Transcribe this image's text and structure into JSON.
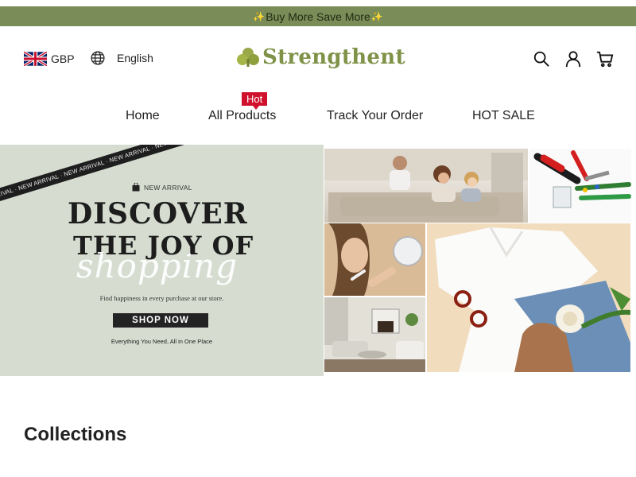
{
  "announcement": {
    "text": "Buy More Save More",
    "spark": "✨"
  },
  "header": {
    "currency": "GBP",
    "language": "English",
    "brand": "Strengthent",
    "colors": {
      "brand": "#7f9248",
      "announcement_bg": "#7a8c57",
      "hot_badge": "#d0112b"
    }
  },
  "nav": {
    "items": [
      {
        "label": "Home"
      },
      {
        "label": "All Products",
        "badge": "Hot"
      },
      {
        "label": "Track Your Order"
      },
      {
        "label": "HOT SALE"
      }
    ]
  },
  "hero": {
    "ribbon": "NEW ARRIVAL · NEW ARRIVAL · NEW ARRIVAL · NEW ARRIVAL · NEW ARRIVAL",
    "kicker": "NEW ARRIVAL",
    "line1": "DISCOVER",
    "line2": "THE JOY OF",
    "script": "shopping",
    "tagline": "Find happiness in every purchase at our store.",
    "cta": "SHOP NOW",
    "footer": "Everything You Need, All in One Place"
  },
  "collections": {
    "title": "Collections"
  }
}
